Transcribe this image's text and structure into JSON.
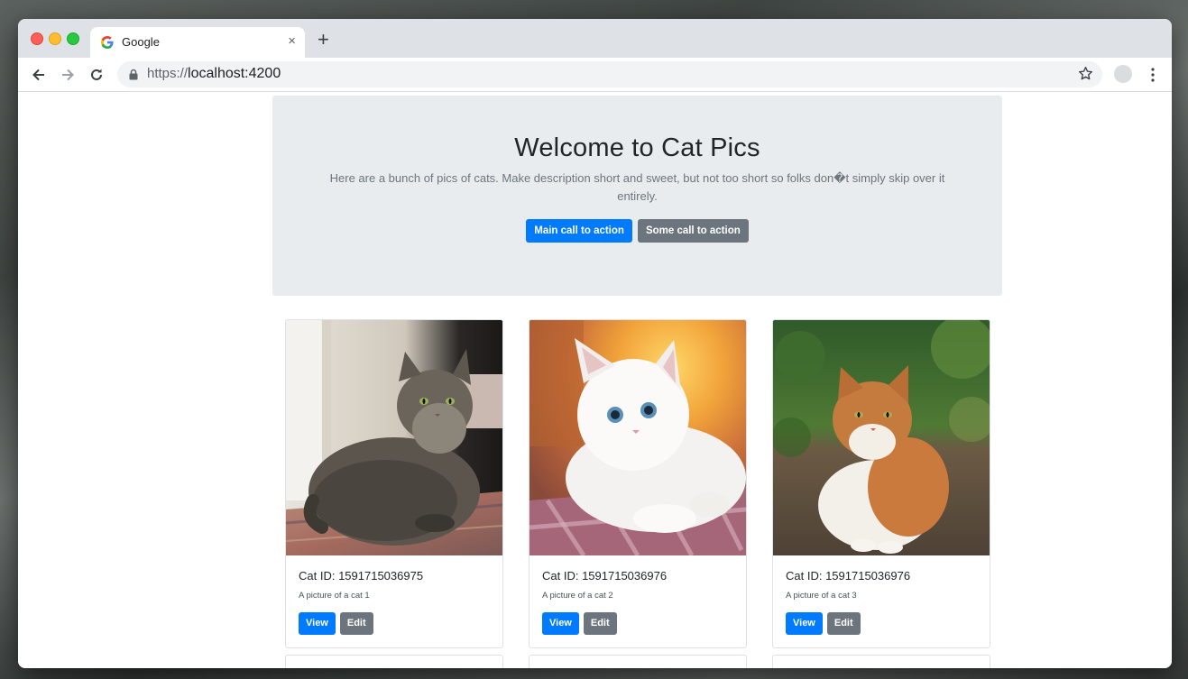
{
  "browser": {
    "tab_title": "Google",
    "tab_close": "×",
    "new_tab": "+",
    "url_scheme": "https://",
    "url_host": "localhost:4200"
  },
  "jumbotron": {
    "title": "Welcome to Cat Pics",
    "lead": "Here are a bunch of pics of cats. Make description short and sweet, but not too short so folks don�t simply skip over it entirely.",
    "primary_button": "Main call to action",
    "secondary_button": "Some call to action"
  },
  "cards": [
    {
      "title": "Cat ID: 1591715036975",
      "text": "A picture of a cat 1",
      "view_label": "View",
      "edit_label": "Edit"
    },
    {
      "title": "Cat ID: 1591715036976",
      "text": "A picture of a cat 2",
      "view_label": "View",
      "edit_label": "Edit"
    },
    {
      "title": "Cat ID: 1591715036976",
      "text": "A picture of a cat 3",
      "view_label": "View",
      "edit_label": "Edit"
    }
  ],
  "colors": {
    "primary": "#007bff",
    "secondary": "#6c757d",
    "jumbotron_bg": "#e9ecef"
  },
  "icons": [
    "back-arrow-icon",
    "forward-arrow-icon",
    "reload-icon",
    "lock-icon",
    "star-icon",
    "kebab-menu-icon",
    "google-favicon-icon"
  ]
}
